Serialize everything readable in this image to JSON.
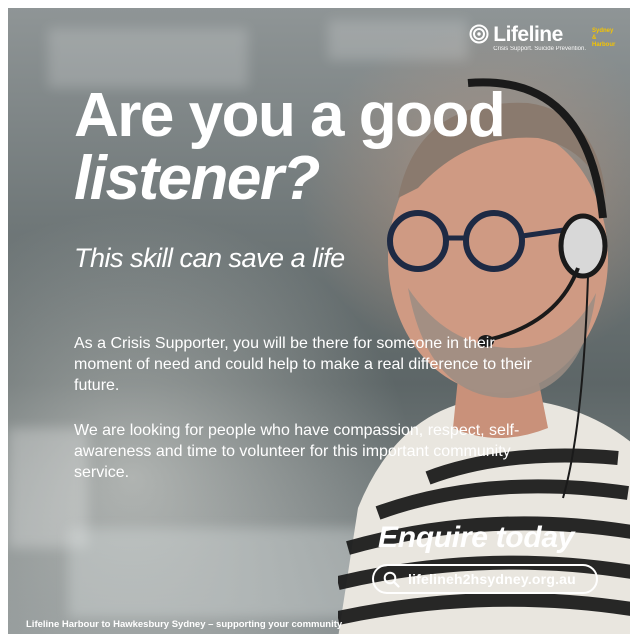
{
  "brand": {
    "logo_word": "Lifeline",
    "logo_tagline": "Crisis Support. Suicide Prevention.",
    "logo_badge": "Sydney & Harbour"
  },
  "headline": {
    "line1": "Are you a good",
    "line2": "listener?"
  },
  "subhead": "This skill can save a life",
  "paragraphs": [
    "As a Crisis Supporter, you will be there for someone in their moment of need and could help to make a real difference to their future.",
    "We are looking for people who have compassion, respect, self-awareness and time to volunteer for this important community service."
  ],
  "cta": {
    "label": "Enquire today",
    "url": "lifelineh2hsydney.org.au",
    "icon": "search-icon"
  },
  "footer": "Lifeline Harbour to Hawkesbury Sydney – supporting your community",
  "colors": {
    "text": "#ffffff",
    "badge": "#f5c400"
  }
}
